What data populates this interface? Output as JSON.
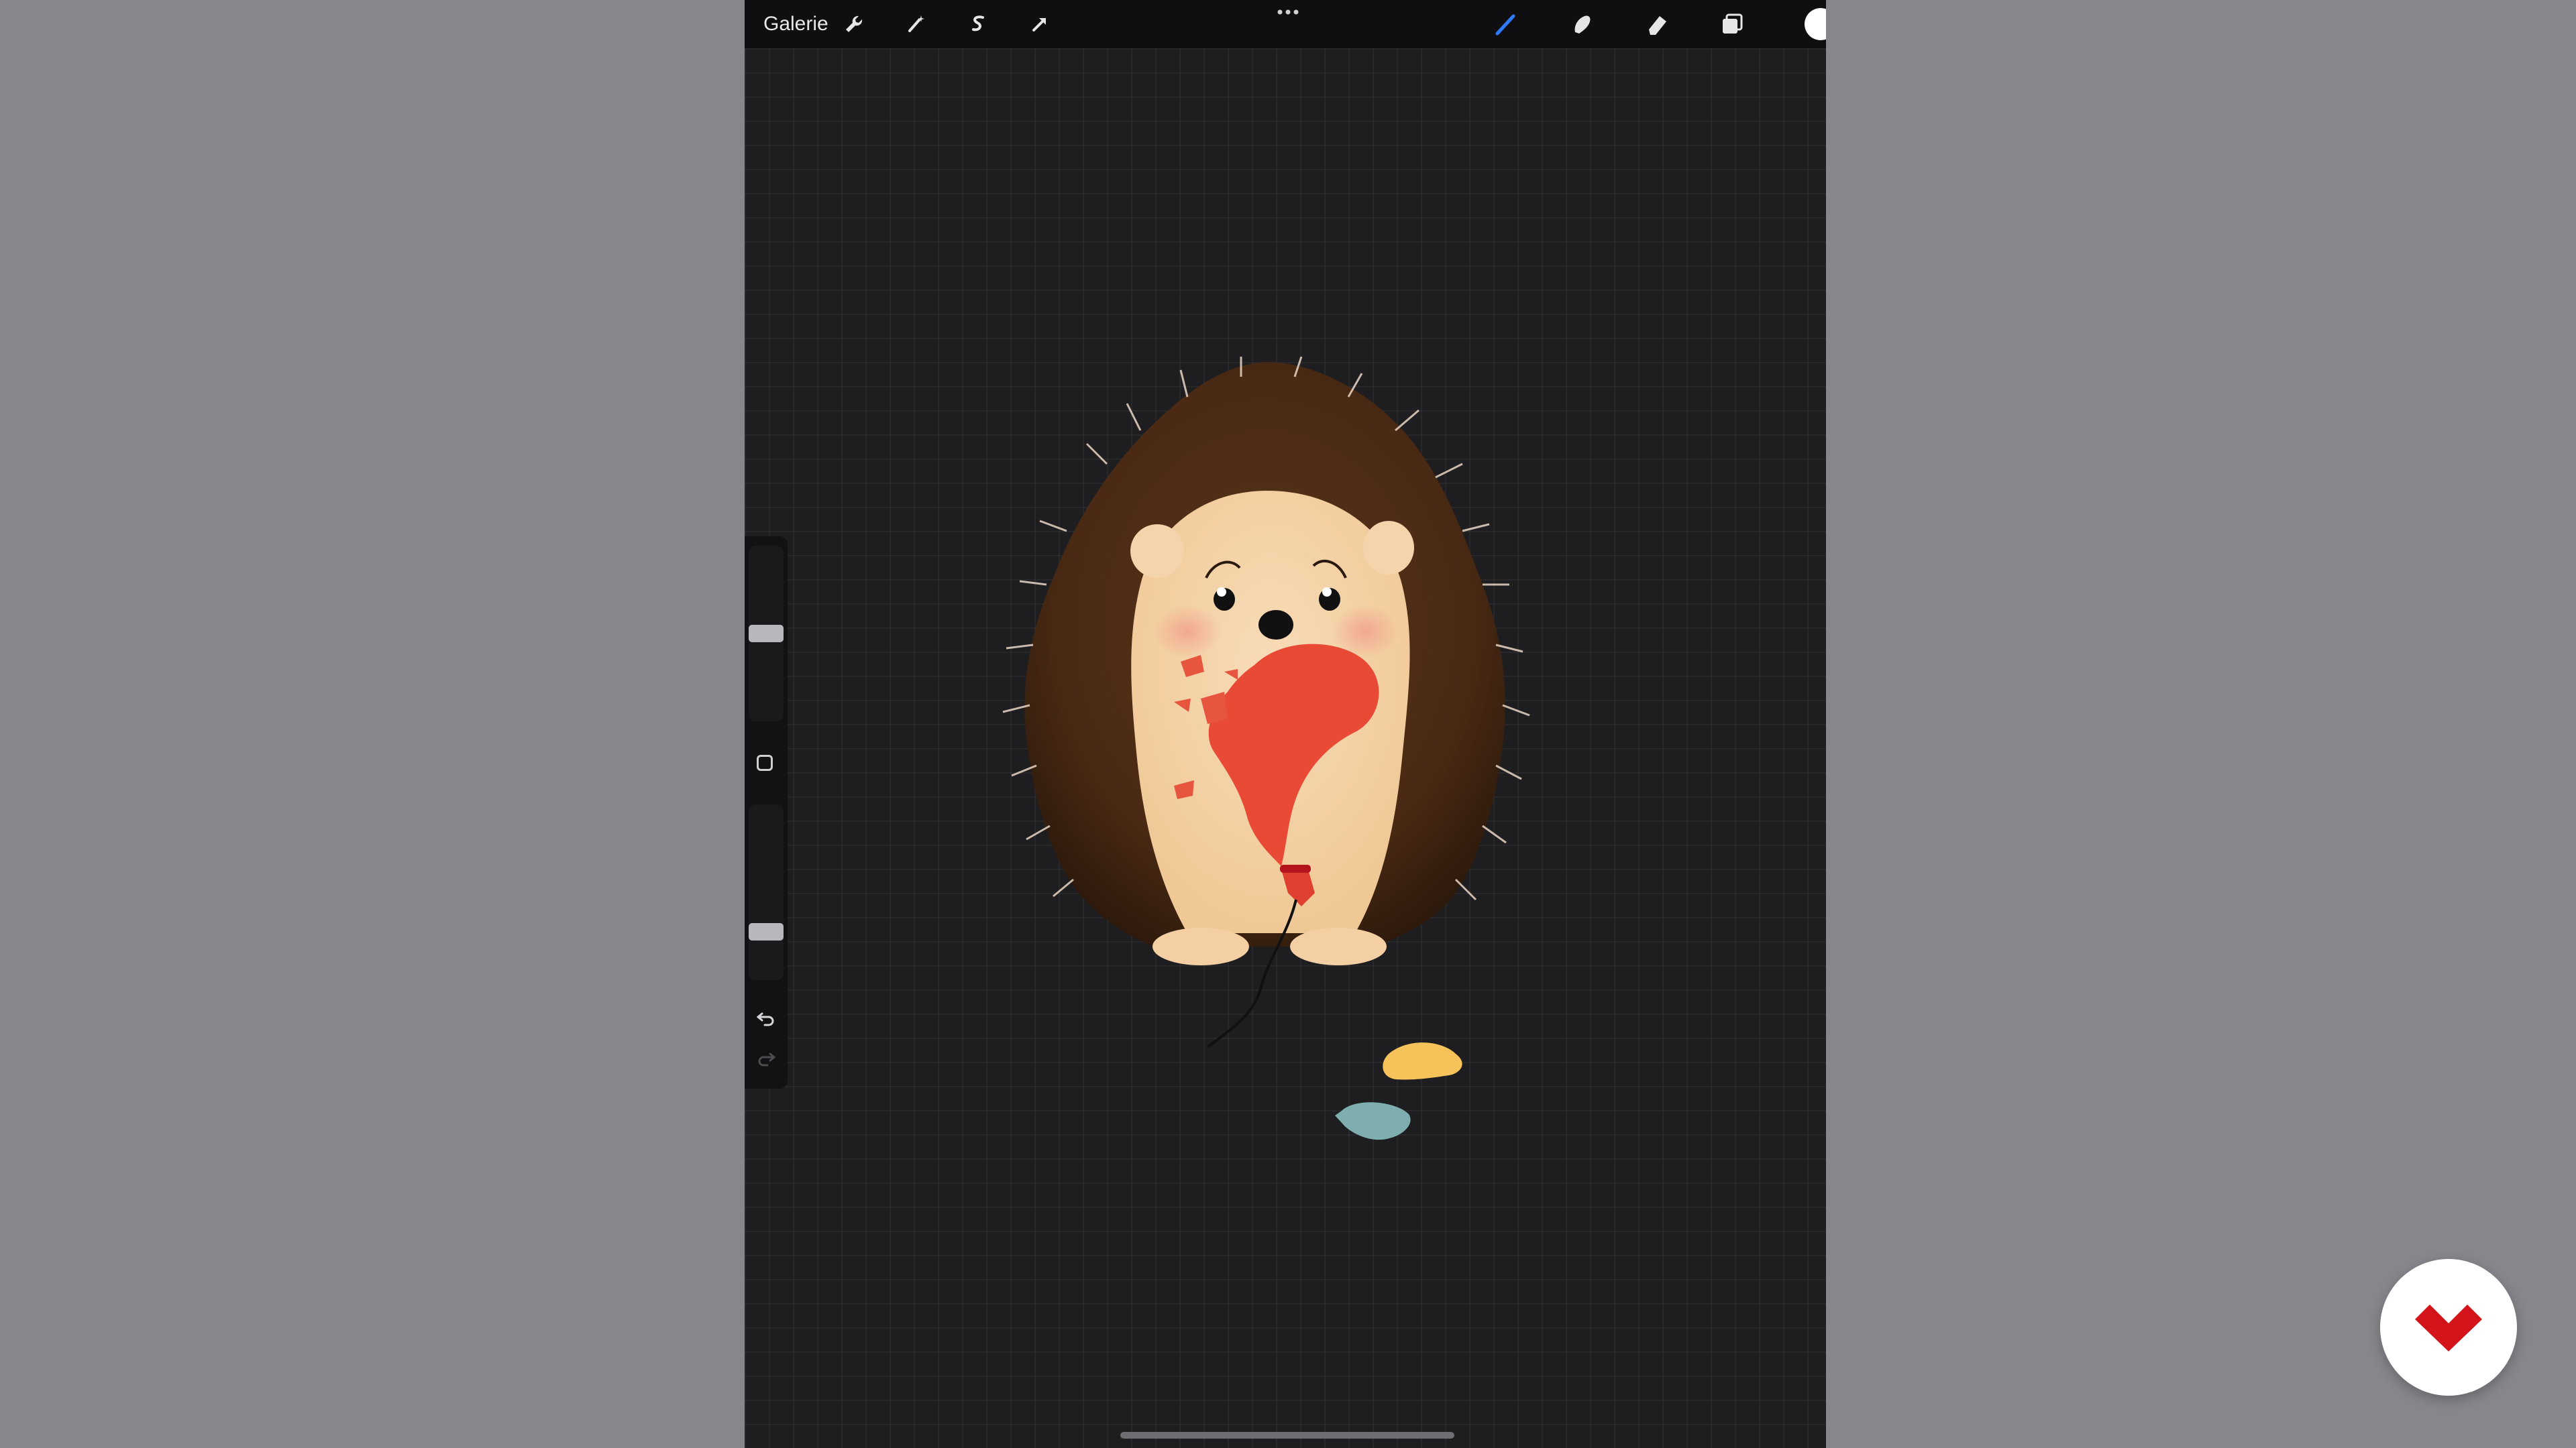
{
  "topbar": {
    "gallery_label": "Galerie",
    "actions": [
      {
        "name": "wrench-icon"
      },
      {
        "name": "magic-wand-icon"
      },
      {
        "name": "selection-icon"
      },
      {
        "name": "transform-arrow-icon"
      }
    ],
    "tools": [
      {
        "name": "brush-icon",
        "active": true
      },
      {
        "name": "smudge-icon"
      },
      {
        "name": "eraser-icon"
      },
      {
        "name": "layers-icon"
      }
    ],
    "current_color": "#ffffff",
    "active_tool_color": "#2f7bf6"
  },
  "sidebar": {
    "brush_size_level": 0.5,
    "opacity_level": 0.25,
    "undo_icon": "undo-icon",
    "redo_icon": "redo-icon"
  },
  "colors": {
    "canvas": "#1e1e21",
    "desktop": "#86878c",
    "brand": "#d3141b"
  }
}
